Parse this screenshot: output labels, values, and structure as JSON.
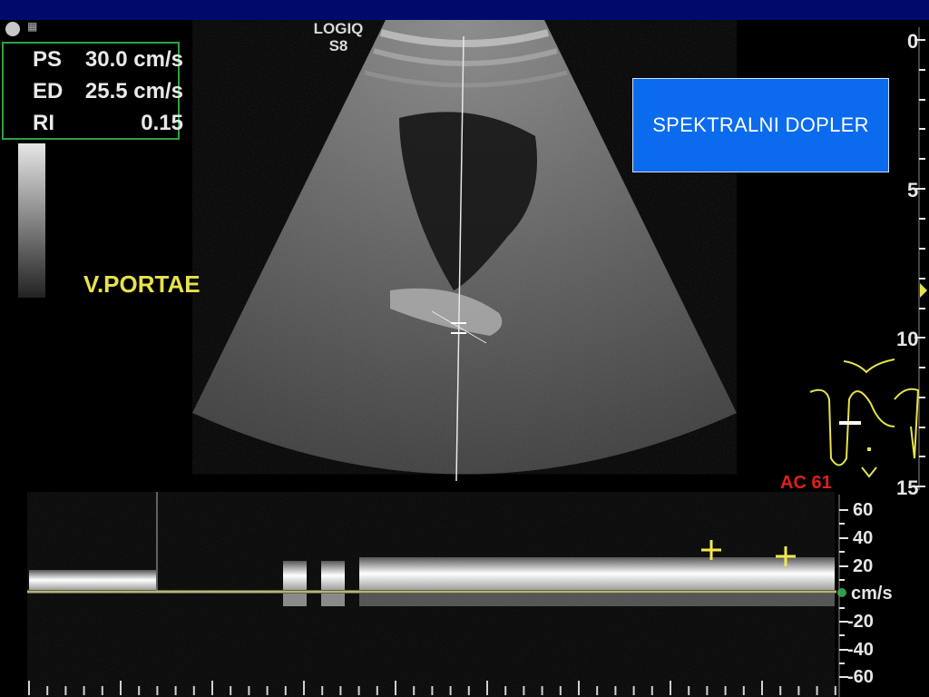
{
  "device": {
    "line1": "LOGIQ",
    "line2": "S8"
  },
  "measurements": [
    {
      "label": "PS",
      "value": "30.0 cm/s"
    },
    {
      "label": "ED",
      "value": "25.5 cm/s"
    },
    {
      "label": "RI",
      "value": "0.15"
    }
  ],
  "vessel_label": "V.PORTAE",
  "title_box": "SPEKTRALNI DOPLER",
  "depth_scale": [
    "0",
    "5",
    "10",
    "15"
  ],
  "ac_label": "AC 61",
  "velocity_scale": [
    "60",
    "40",
    "20",
    "-20",
    "-40",
    "-60"
  ],
  "velocity_unit": "cm/s",
  "colors": {
    "header": "#000a6b",
    "measure_border": "#2ea043",
    "label_yellow": "#e7e24a",
    "title_box": "#0a6bee",
    "ac_red": "#e0201c",
    "baseline": "#b8b47a"
  }
}
